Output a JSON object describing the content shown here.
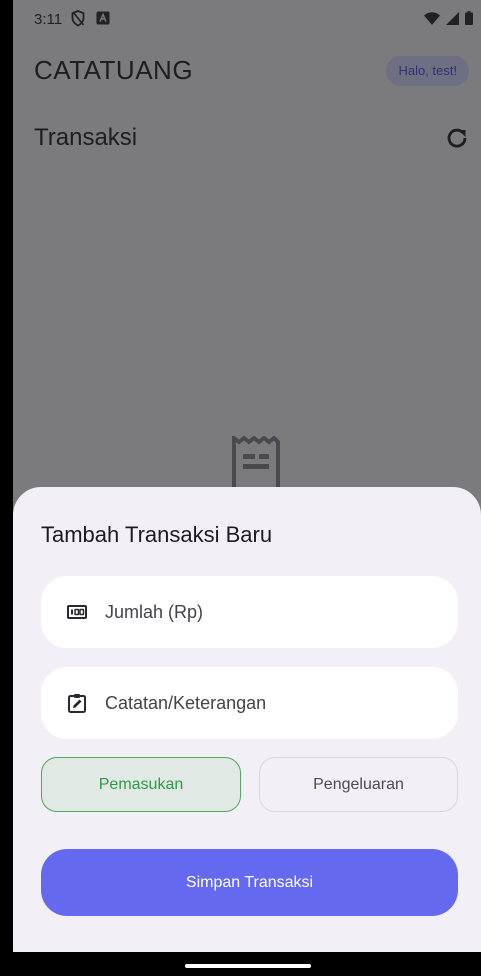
{
  "status_bar": {
    "time": "3:11",
    "icons": [
      "vpn-shield-icon",
      "notification-a-icon",
      "wifi-icon",
      "signal-icon",
      "battery-icon"
    ]
  },
  "header": {
    "app_title": "CATATUANG",
    "greeting": "Halo, test!"
  },
  "main": {
    "section_title": "Transaksi",
    "refresh_icon": "refresh-icon",
    "empty_state_icon": "receipt-icon"
  },
  "sheet": {
    "title": "Tambah Transaksi Baru",
    "amount_field": {
      "placeholder": "Jumlah (Rp)",
      "value": "",
      "icon": "cash-icon"
    },
    "note_field": {
      "placeholder": "Catatan/Keterangan",
      "value": "",
      "icon": "clipboard-edit-icon"
    },
    "type_options": {
      "income_label": "Pemasukan",
      "expense_label": "Pengeluaran",
      "selected": "Pemasukan"
    },
    "save_label": "Simpan Transaksi"
  },
  "colors": {
    "accent": "#6569f0",
    "income": "#2e9a47",
    "sheet_background": "#f3eff6",
    "scrim": "#7b7a7d"
  }
}
